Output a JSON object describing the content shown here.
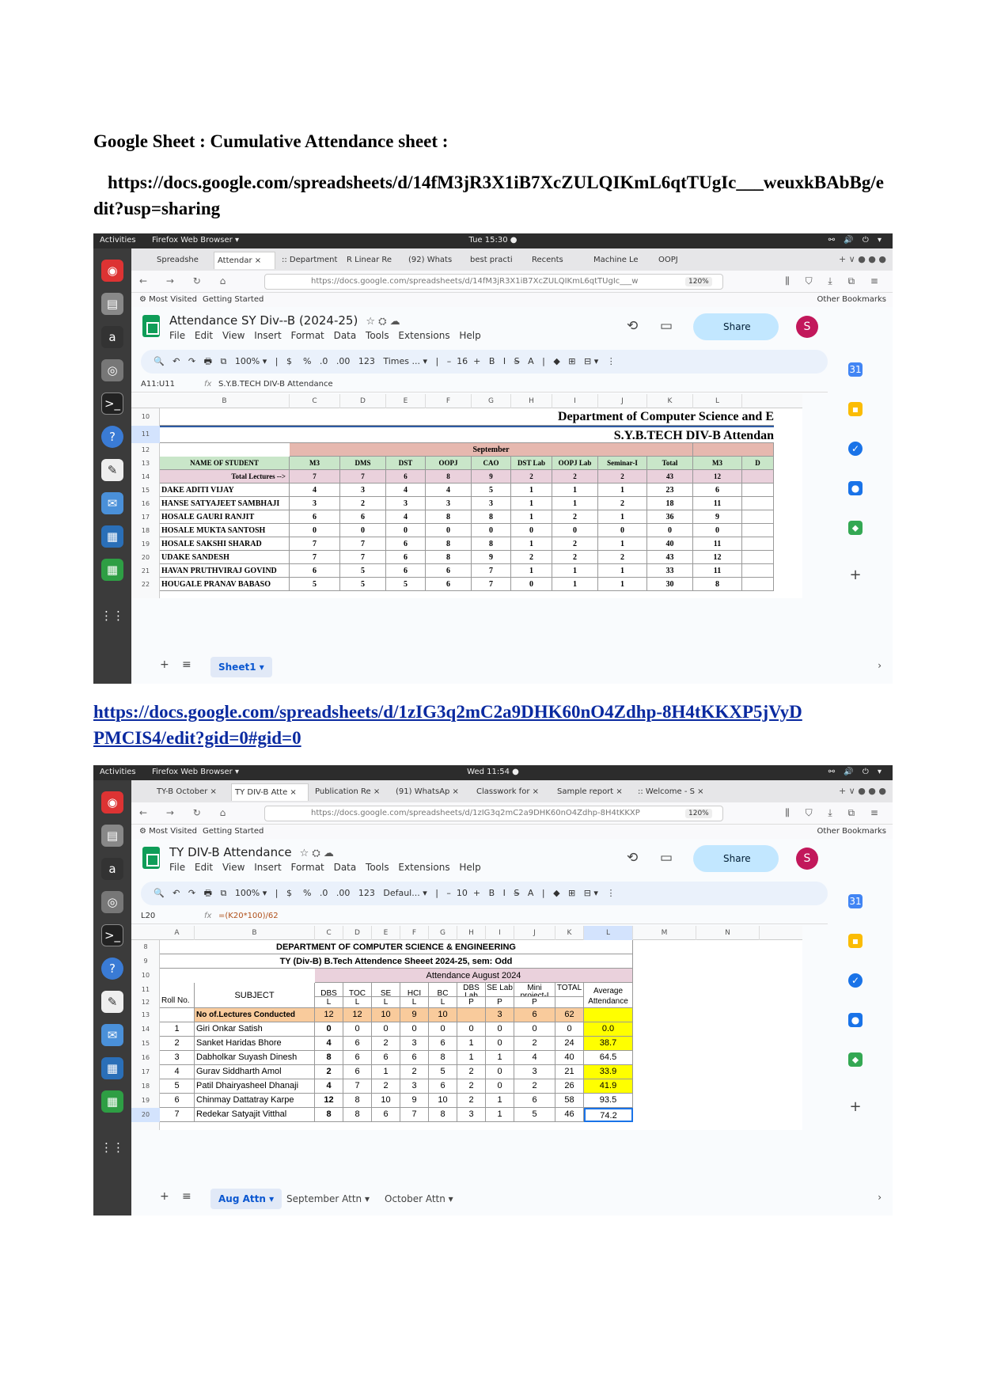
{
  "doc": {
    "title": "Google Sheet : Cumulative Attendance sheet  :",
    "link1": "https://docs.google.com/spreadsheets/d/14fM3jR3X1iB7XcZULQIKmL6qtTUgIc___weuxkBAbBg/edit?usp=sharing",
    "link2": "https://docs.google.com/spreadsheets/d/1zIG3q2mC2a9DHK60nO4Zdhp-8H4tKKXP5jVyDPMCIS4/edit?gid=0#gid=0"
  },
  "shot1": {
    "activities": "Activities",
    "browser": "Firefox Web Browser ▾",
    "clock": "Tue 15:30 ●",
    "tabs": [
      "Spreadshe",
      "Attendar ×",
      ":: Department",
      "R Linear Re",
      "(92) Whats",
      "best practi",
      "Recents",
      "Machine Le",
      "OOPJ"
    ],
    "url": "https://docs.google.com/spreadsheets/d/14fM3jR3X1iB7XcZULQIKmL6qtTUgIc___w",
    "zoom": "120%",
    "most_visited": "⚙ Most Visited",
    "getting_started": "Getting Started",
    "other_bookmarks": "Other Bookmarks",
    "doc_title": "Attendance SY Div--B (2024-25)",
    "menu": "File Edit View Insert Format Data Tools Extensions Help",
    "share": "Share",
    "avatar": "S",
    "toolbar": "🔍   ↶   ↷   🖶   ⧉   100% ▾   |   $    %   .0   .00   123   Times ... ▾   |   –  16  +   B   I   S̶   A   |   ◆   ⊞   ⊟ ▾   ⋮",
    "cellref": "A11:U11",
    "fx": "fx",
    "formula": "S.Y.B.TECH DIV-B  Attendance",
    "sheet_tab": "Sheet1 ▾"
  },
  "shot2": {
    "activities": "Activities",
    "browser": "Firefox Web Browser ▾",
    "clock": "Wed 11:54 ●",
    "tabs": [
      "TY-B October ×",
      "TY DIV-B Atte ×",
      "Publication Re ×",
      "(91) WhatsAp ×",
      "Classwork for ×",
      "Sample report ×",
      ":: Welcome - S ×"
    ],
    "url": "https://docs.google.com/spreadsheets/d/1zIG3q2mC2a9DHK60nO4Zdhp-8H4tKKXP",
    "zoom": "120%",
    "most_visited": "⚙ Most Visited",
    "getting_started": "Getting Started",
    "other_bookmarks": "Other Bookmarks",
    "doc_title": "TY  DIV-B Attendance",
    "menu": "File Edit View Insert Format Data Tools Extensions Help",
    "share": "Share",
    "avatar": "S",
    "toolbar": "🔍   ↶   ↷   🖶   ⧉   100% ▾   |   $    %   .0   .00   123   Defaul... ▾   |   –  10  +   B   I   S̶   A   |   ◆   ⊞   ⊟ ▾   ⋮",
    "cellref": "L20",
    "fx": "fx",
    "formula": "=(K20*100)/62",
    "sheet_tabs": [
      "Aug Attn ▾",
      "September Attn ▾",
      "October Attn ▾"
    ]
  },
  "grid1": {
    "cols": [
      "B",
      "C",
      "D",
      "E",
      "F",
      "G",
      "H",
      "I",
      "J",
      "K",
      "L"
    ],
    "rownums": [
      "10",
      "11",
      "12",
      "13",
      "14",
      "15",
      "16",
      "17",
      "18",
      "19",
      "20",
      "21",
      "22"
    ],
    "title1": "Department of Computer Science and E",
    "title2": "S.Y.B.TECH DIV-B  Attendan",
    "month": "September",
    "header": [
      "NAME OF STUDENT",
      "M3",
      "DMS",
      "DST",
      "OOPJ",
      "CAO",
      "DST Lab",
      "OOPJ Lab",
      "Seminar-I",
      "Total",
      "M3",
      "D"
    ],
    "total": [
      "Total Lectures -->",
      "7",
      "7",
      "6",
      "8",
      "9",
      "2",
      "2",
      "2",
      "43",
      "12",
      ""
    ],
    "rows": [
      [
        "DAKE ADITI VIJAY",
        "4",
        "3",
        "4",
        "4",
        "5",
        "1",
        "1",
        "1",
        "23",
        "6",
        ""
      ],
      [
        "HANSE SATYAJEET SAMBHAJI",
        "3",
        "2",
        "3",
        "3",
        "3",
        "1",
        "1",
        "2",
        "18",
        "11",
        ""
      ],
      [
        "HOSALE GAURI RANJIT",
        "6",
        "6",
        "4",
        "8",
        "8",
        "1",
        "2",
        "1",
        "36",
        "9",
        ""
      ],
      [
        "HOSALE MUKTA SANTOSH",
        "0",
        "0",
        "0",
        "0",
        "0",
        "0",
        "0",
        "0",
        "0",
        "0",
        ""
      ],
      [
        "HOSALE SAKSHI SHARAD",
        "7",
        "7",
        "6",
        "8",
        "8",
        "1",
        "2",
        "1",
        "40",
        "11",
        ""
      ],
      [
        "UDAKE SANDESH CHANDRAKANT",
        "7",
        "7",
        "6",
        "8",
        "9",
        "2",
        "2",
        "2",
        "43",
        "12",
        ""
      ],
      [
        "HAVAN PRUTHVIRAJ GOVIND",
        "6",
        "5",
        "6",
        "6",
        "7",
        "1",
        "1",
        "1",
        "33",
        "11",
        ""
      ],
      [
        "HOUGALE PRANAV BABASO",
        "5",
        "5",
        "5",
        "6",
        "7",
        "0",
        "1",
        "1",
        "30",
        "8",
        ""
      ]
    ]
  },
  "grid2": {
    "cols": [
      "A",
      "B",
      "C",
      "D",
      "E",
      "F",
      "G",
      "H",
      "I",
      "J",
      "K",
      "L",
      "M",
      "N"
    ],
    "rownums": [
      "8",
      "9",
      "10",
      "11",
      "12",
      "13",
      "14",
      "15",
      "16",
      "17",
      "18",
      "19",
      "20"
    ],
    "title1": "DEPARTMENT OF COMPUTER SCIENCE & ENGINEERING",
    "title2": "TY (Div-B) B.Tech  Attendence Sheeet 2024-25, sem: Odd",
    "month": "Attendance August 2024",
    "subject": "SUBJECT",
    "rollno": "Roll No.",
    "subjects": [
      "DBS",
      "TOC",
      "SE",
      "HCI",
      "BC",
      "DBS Lab",
      "SE Lab",
      "Mini project-I",
      "TOTAL"
    ],
    "types": [
      "L",
      "L",
      "L",
      "L",
      "L",
      "P",
      "P",
      "P",
      ""
    ],
    "avg": "Average Attendance",
    "conducted_label": "No of.Lectures Conducted",
    "conducted": [
      "12",
      "12",
      "10",
      "9",
      "10",
      "",
      "3",
      "6",
      "62"
    ],
    "rows": [
      [
        "1",
        "Giri Onkar Satish",
        "0",
        "0",
        "0",
        "0",
        "0",
        "0",
        "0",
        "0",
        "0",
        "0.0"
      ],
      [
        "2",
        "Sanket Haridas Bhore",
        "4",
        "6",
        "2",
        "3",
        "6",
        "1",
        "0",
        "2",
        "24",
        "38.7"
      ],
      [
        "3",
        "Dabholkar Suyash Dinesh",
        "8",
        "6",
        "6",
        "6",
        "8",
        "1",
        "1",
        "4",
        "40",
        "64.5"
      ],
      [
        "4",
        "Gurav Siddharth Amol",
        "2",
        "6",
        "1",
        "2",
        "5",
        "2",
        "0",
        "3",
        "21",
        "33.9"
      ],
      [
        "5",
        "Patil Dhairyasheel Dhanaji",
        "4",
        "7",
        "2",
        "3",
        "6",
        "2",
        "0",
        "2",
        "26",
        "41.9"
      ],
      [
        "6",
        "Chinmay Dattatray Karpe",
        "12",
        "8",
        "10",
        "9",
        "10",
        "2",
        "1",
        "6",
        "58",
        "93.5"
      ],
      [
        "7",
        "Redekar Satyajit Vitthal",
        "8",
        "8",
        "6",
        "7",
        "8",
        "3",
        "1",
        "5",
        "46",
        "74.2"
      ]
    ],
    "low_color": "#ffff00"
  }
}
